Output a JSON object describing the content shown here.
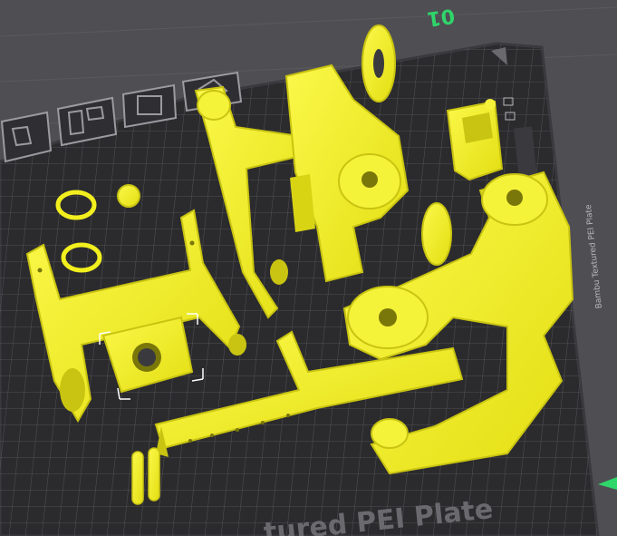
{
  "viewport": {
    "plate_label": "tured PEI Plate",
    "plate_number": "01",
    "side_label": "Bambu Textured PEI Plate",
    "colors": {
      "background": "#4f4f53",
      "plate": "#2b2b2e",
      "plate_edge": "#3a3a3e",
      "grid": "#5c5c60",
      "model": "#f2ef1e",
      "model_shadow": "#c9c411",
      "model_dark": "#a8a50c",
      "accent_green": "#2fd66a",
      "icon_stroke": "#9a9aa0"
    }
  },
  "plate_icons": [
    {
      "name": "arrange-icon"
    },
    {
      "name": "layout-icon"
    },
    {
      "name": "lock-icon"
    },
    {
      "name": "orient-icon"
    }
  ],
  "models": [
    {
      "name": "left-frame-part"
    },
    {
      "name": "center-arm-part"
    },
    {
      "name": "right-arm-part"
    },
    {
      "name": "small-bracket-part"
    },
    {
      "name": "long-rail-part"
    },
    {
      "name": "selected-mount-part"
    },
    {
      "name": "ring-part-1"
    },
    {
      "name": "ring-part-2"
    },
    {
      "name": "knob-part"
    },
    {
      "name": "pin-part-1"
    },
    {
      "name": "pin-part-2"
    }
  ]
}
